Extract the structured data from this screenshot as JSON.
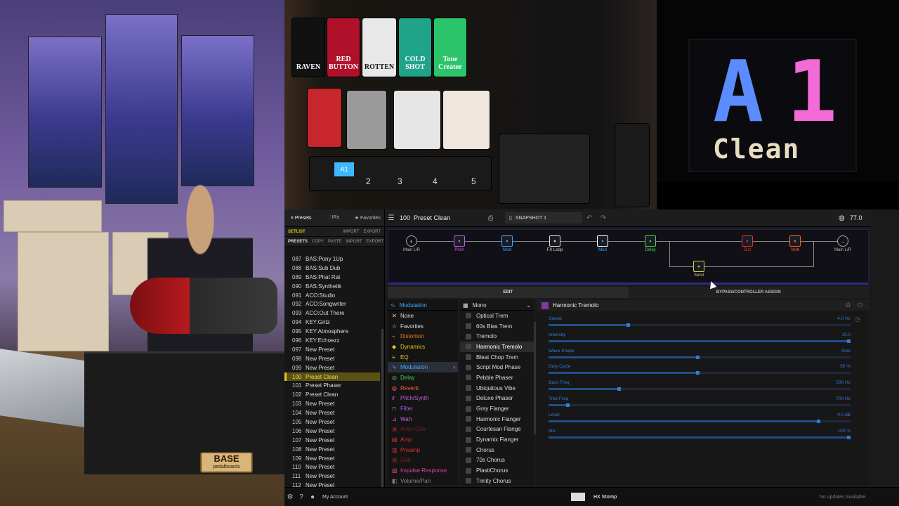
{
  "overlay": {
    "display": {
      "bank": "A",
      "number": "1",
      "name": "Clean"
    },
    "pedal_names": [
      "RAVEN",
      "RED BUTTON",
      "ROTTEN",
      "COLD SHOT",
      "Tone Creator"
    ],
    "footswitch_labels": [
      "A1",
      "2",
      "3",
      "4",
      "5"
    ],
    "base_plate": {
      "title": "BASE",
      "subtitle": "pedalboards"
    }
  },
  "left_panel": {
    "tabs": [
      "Presets",
      "IRs",
      "Favorites"
    ],
    "setlist": {
      "label": "SETLIST",
      "actions": [
        "IMPORT",
        "EXPORT"
      ]
    },
    "presets_bar": {
      "label": "PRESETS",
      "actions": [
        "COPY",
        "PASTE",
        "IMPORT",
        "EXPORT"
      ]
    },
    "presets": [
      {
        "num": "087",
        "name": "BAS:Pony 1Up"
      },
      {
        "num": "088",
        "name": "BAS:Sub Dub"
      },
      {
        "num": "089",
        "name": "BAS:Phat Rat"
      },
      {
        "num": "090",
        "name": "BAS:Synthetik"
      },
      {
        "num": "091",
        "name": "ACO:Studio"
      },
      {
        "num": "092",
        "name": "ACO:Songwriter"
      },
      {
        "num": "093",
        "name": "ACO:Out There"
      },
      {
        "num": "094",
        "name": "KEY:Gritz"
      },
      {
        "num": "095",
        "name": "KEY:Atmosphere"
      },
      {
        "num": "096",
        "name": "KEY:Echoezz"
      },
      {
        "num": "097",
        "name": "New Preset"
      },
      {
        "num": "098",
        "name": "New Preset"
      },
      {
        "num": "099",
        "name": "New Preset"
      },
      {
        "num": "100",
        "name": "Preset Clean",
        "selected": true
      },
      {
        "num": "101",
        "name": "Preset Phaser"
      },
      {
        "num": "102",
        "name": "Preset Clean"
      },
      {
        "num": "103",
        "name": "New Preset"
      },
      {
        "num": "104",
        "name": "New Preset"
      },
      {
        "num": "105",
        "name": "New Preset"
      },
      {
        "num": "106",
        "name": "New Preset"
      },
      {
        "num": "107",
        "name": "New Preset"
      },
      {
        "num": "108",
        "name": "New Preset"
      },
      {
        "num": "109",
        "name": "New Preset"
      },
      {
        "num": "110",
        "name": "New Preset"
      },
      {
        "num": "111",
        "name": "New Preset"
      },
      {
        "num": "112",
        "name": "New Preset"
      }
    ]
  },
  "topbar": {
    "preset_number": "100",
    "preset_name": "Preset Clean",
    "snapshot": "SNAPSHOT 1",
    "tempo": "77.0"
  },
  "signal_flow": {
    "blocks": [
      {
        "label": "Main L/R",
        "color": "#bbbbbb",
        "kind": "io"
      },
      {
        "label": "Pitch",
        "color": "#c060e0"
      },
      {
        "label": "Mod",
        "color": "#3fa0ff"
      },
      {
        "label": "FX Loop",
        "color": "#dddddd"
      },
      {
        "label": "Mod",
        "color": "#3fa0ff",
        "selected": true
      },
      {
        "label": "Delay",
        "color": "#4fd04f"
      },
      {
        "label": "Dist",
        "color": "#e03030"
      },
      {
        "label": "Verb",
        "color": "#ff6030"
      },
      {
        "label": "Main L/R",
        "color": "#bbbbbb",
        "kind": "io"
      },
      {
        "label": "Send",
        "color": "#cfd060"
      }
    ]
  },
  "edit_tabs": [
    "EDIT",
    "BYPASS/CONTROLLER ASSIGN"
  ],
  "categories": {
    "header": "Modulation",
    "items": [
      {
        "label": "None",
        "color": "#dddddd",
        "icon": "none-icon"
      },
      {
        "label": "Favorites",
        "color": "#dddddd",
        "icon": "star-icon"
      },
      {
        "label": "Distortion",
        "color": "#e87a20",
        "icon": "distortion-icon"
      },
      {
        "label": "Dynamics",
        "color": "#e6c619",
        "icon": "dynamics-icon"
      },
      {
        "label": "EQ",
        "color": "#e6c619",
        "icon": "eq-icon"
      },
      {
        "label": "Modulation",
        "color": "#3fa9ff",
        "icon": "modulation-icon",
        "selected": true
      },
      {
        "label": "Delay",
        "color": "#4fd04f",
        "icon": "delay-icon"
      },
      {
        "label": "Reverb",
        "color": "#ff6030",
        "icon": "reverb-icon"
      },
      {
        "label": "Pitch/Synth",
        "color": "#c060e0",
        "icon": "pitch-icon"
      },
      {
        "label": "Filter",
        "color": "#a060e0",
        "icon": "filter-icon"
      },
      {
        "label": "Wah",
        "color": "#c060e0",
        "icon": "wah-icon"
      },
      {
        "label": "Amp+Cab",
        "color": "#7a2020",
        "icon": "ampcab-icon"
      },
      {
        "label": "Amp",
        "color": "#e03030",
        "icon": "amp-icon"
      },
      {
        "label": "Preamp",
        "color": "#e03030",
        "icon": "preamp-icon"
      },
      {
        "label": "Cab",
        "color": "#7a2020",
        "icon": "cab-icon"
      },
      {
        "label": "Impulse Response",
        "color": "#e040a0",
        "icon": "ir-icon"
      },
      {
        "label": "Volume/Pan",
        "color": "#888888",
        "icon": "volume-icon"
      }
    ]
  },
  "models": {
    "mode": "Mono",
    "items": [
      "Optical Trem",
      "60s Bias Trem",
      "Tremolo",
      "Harmonic Tremolo",
      "Bleat Chop Trem",
      "Script Mod Phase",
      "Pebble Phaser",
      "Ubiquitous Vibe",
      "Deluxe Phaser",
      "Gray Flanger",
      "Harmonic Flanger",
      "Courtesan Flange",
      "Dynamix Flanger",
      "Chorus",
      "70s Chorus",
      "PlastiChorus",
      "Trinity Chorus"
    ],
    "selected": "Harmonic Tremolo"
  },
  "params": {
    "model_name": "Harmonic Tremolo",
    "items": [
      {
        "name": "Speed",
        "value": "4.0 Hz",
        "level": 0.27
      },
      {
        "name": "Intensity",
        "value": "10.0",
        "level": 1.0
      },
      {
        "name": "Wave Shape",
        "value": "Sine",
        "level": 0.5
      },
      {
        "name": "Duty Cycle",
        "value": "50 %",
        "level": 0.5
      },
      {
        "name": "Bass Freq",
        "value": "500 Hz",
        "level": 0.24
      },
      {
        "name": "Treb Freq",
        "value": "700 Hz",
        "level": 0.07
      },
      {
        "name": "Level",
        "value": "0.0 dB",
        "level": 0.9
      },
      {
        "name": "Mix",
        "value": "100 %",
        "level": 1.0
      }
    ]
  },
  "status": {
    "account": "My Account",
    "device": "HX Stomp",
    "updates": "No updates available."
  }
}
